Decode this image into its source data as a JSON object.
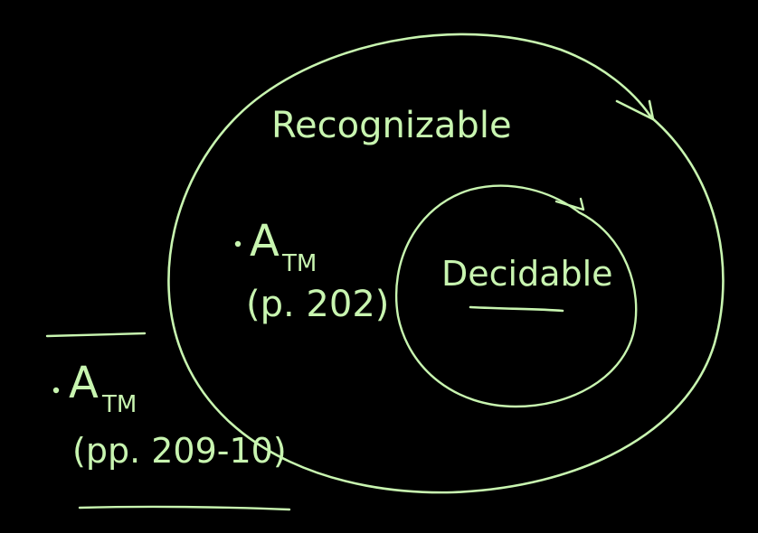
{
  "colors": {
    "background": "#000000",
    "chalk": "#c8f5b0"
  },
  "outer_set": {
    "label": "Recognizable"
  },
  "inner_set": {
    "label": "Decidable"
  },
  "inside_item": {
    "letter": "A",
    "subscript": "TM",
    "reference": "(p. 202)"
  },
  "outside_item": {
    "letter": "A",
    "subscript": "TM",
    "reference": "(pp. 209-10)"
  }
}
